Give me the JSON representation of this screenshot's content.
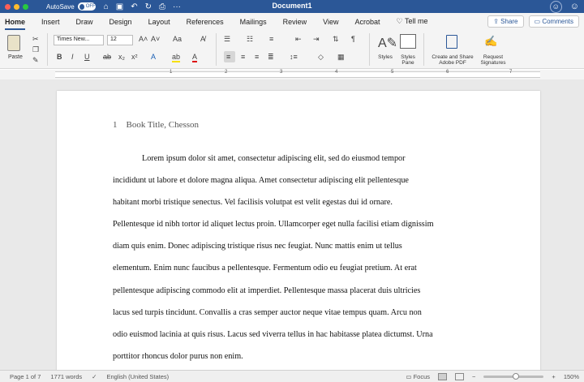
{
  "titlebar": {
    "autosave_label": "AutoSave",
    "autosave_state": "OFF",
    "document_title": "Document1"
  },
  "tabs": [
    "Home",
    "Insert",
    "Draw",
    "Design",
    "Layout",
    "References",
    "Mailings",
    "Review",
    "View",
    "Acrobat",
    "Tell me"
  ],
  "tabs_right": {
    "share_label": "Share",
    "comments_label": "Comments"
  },
  "ribbon": {
    "paste_label": "Paste",
    "font_name": "Times New...",
    "font_size": "12",
    "styles_label": "Styles",
    "styles_pane_label_1": "Styles",
    "styles_pane_label_2": "Pane",
    "create_pdf_label_1": "Create and Share",
    "create_pdf_label_2": "Adobe PDF",
    "request_sig_label_1": "Request",
    "request_sig_label_2": "Signatures",
    "bold": "B",
    "italic": "I",
    "underline": "U",
    "strike": "ab",
    "subscript": "x₂",
    "superscript": "x²",
    "font_color_glyph": "A",
    "highlight_glyph": "ab"
  },
  "ruler": {
    "numbers": [
      "1",
      "2",
      "3",
      "4",
      "5",
      "6",
      "7"
    ]
  },
  "document": {
    "header_page_number": "1",
    "header_text": "Book Title, Chesson",
    "paragraph_lines": [
      "Lorem ipsum dolor sit amet, consectetur adipiscing elit, sed do eiusmod tempor",
      "incididunt ut labore et dolore magna aliqua. Amet consectetur adipiscing elit pellentesque",
      "habitant morbi tristique senectus. Vel facilisis volutpat est velit egestas dui id ornare.",
      "Pellentesque id nibh tortor id aliquet lectus proin. Ullamcorper eget nulla facilisi etiam dignissim",
      "diam quis enim. Donec adipiscing tristique risus nec feugiat. Nunc mattis enim ut tellus",
      "elementum. Enim nunc faucibus a pellentesque. Fermentum odio eu feugiat pretium. At erat",
      "pellentesque adipiscing commodo elit at imperdiet. Pellentesque massa placerat duis ultricies",
      "lacus sed turpis tincidunt. Convallis a cras semper auctor neque vitae tempus quam. Arcu non",
      "odio euismod lacinia at quis risus. Lacus sed viverra tellus in hac habitasse platea dictumst. Urna",
      "porttitor rhoncus dolor purus non enim."
    ]
  },
  "statusbar": {
    "page_info": "Page 1 of 7",
    "word_count": "1771 words",
    "language": "English (United States)",
    "focus_label": "Focus",
    "zoom": "150%"
  },
  "colors": {
    "title_bar": "#2b5797",
    "accent": "#2b5797"
  }
}
